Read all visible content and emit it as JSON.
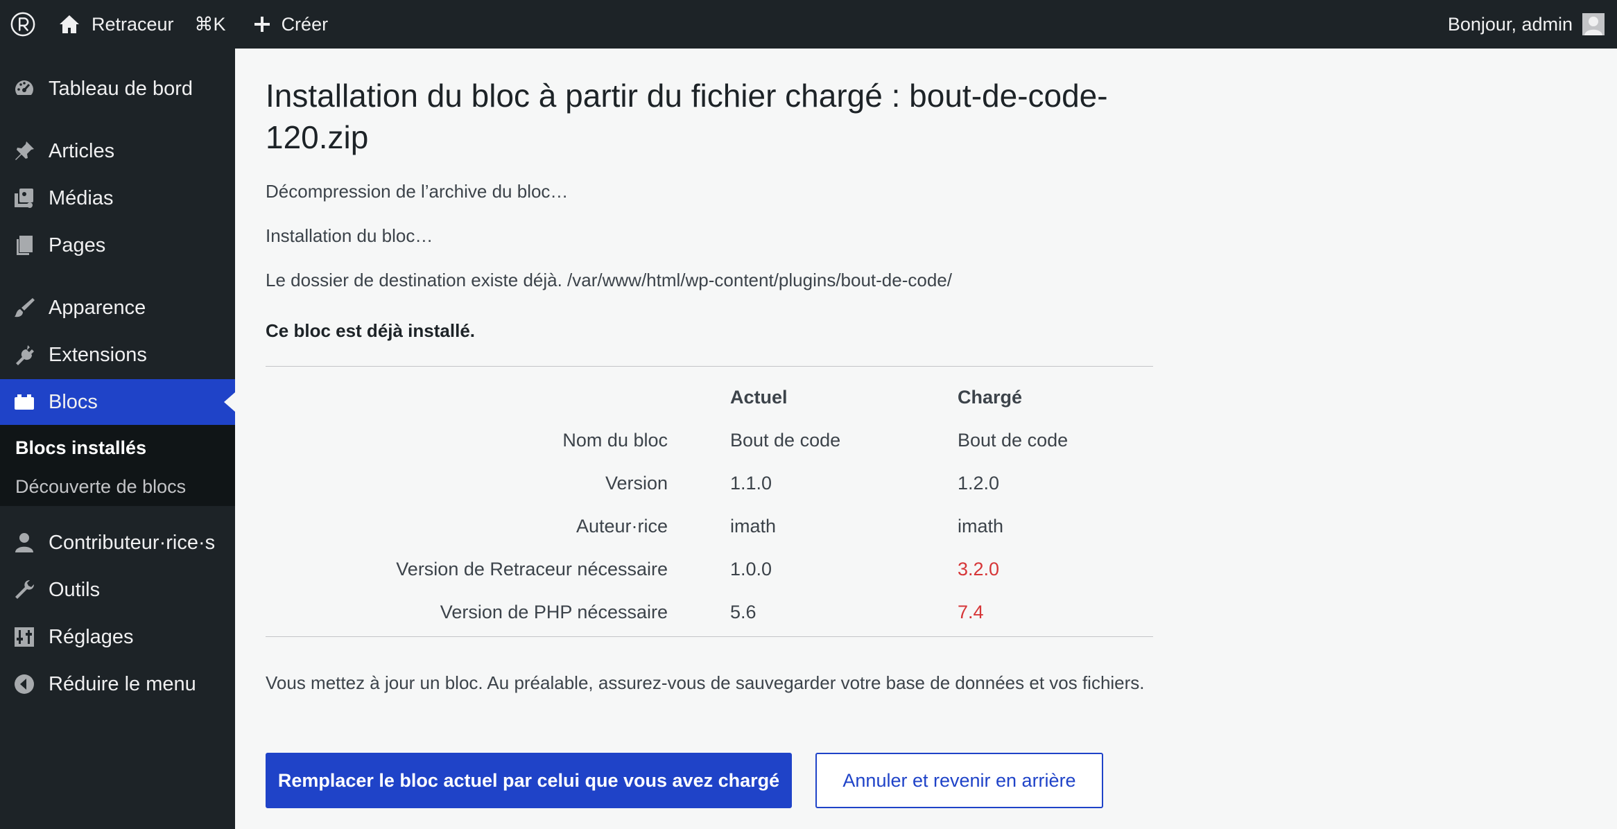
{
  "adminbar": {
    "site_name": "Retraceur",
    "shortcut": "⌘K",
    "new_label": "Créer",
    "greeting": "Bonjour, admin"
  },
  "sidebar": {
    "items": [
      {
        "label": "Tableau de bord",
        "icon": "dashboard-icon"
      },
      {
        "label": "Articles",
        "icon": "pin-icon"
      },
      {
        "label": "Médias",
        "icon": "media-icon"
      },
      {
        "label": "Pages",
        "icon": "pages-icon"
      },
      {
        "label": "Apparence",
        "icon": "brush-icon"
      },
      {
        "label": "Extensions",
        "icon": "plugin-icon"
      },
      {
        "label": "Blocs",
        "icon": "blocks-icon",
        "current": true
      },
      {
        "label": "Contributeur·rice·s",
        "icon": "user-icon"
      },
      {
        "label": "Outils",
        "icon": "wrench-icon"
      },
      {
        "label": "Réglages",
        "icon": "settings-icon"
      },
      {
        "label": "Réduire le menu",
        "icon": "collapse-icon"
      }
    ],
    "submenu": [
      {
        "label": "Blocs installés",
        "active": true
      },
      {
        "label": "Découverte de blocs"
      }
    ]
  },
  "main": {
    "title": "Installation du bloc à partir du fichier chargé : bout-de-code-120.zip",
    "messages": [
      "Décompression de l’archive du bloc…",
      "Installation du bloc…",
      "Le dossier de destination existe déjà. /var/www/html/wp-content/plugins/bout-de-code/"
    ],
    "already_installed": "Ce bloc est déjà installé.",
    "table": {
      "headers": {
        "current": "Actuel",
        "uploaded": "Chargé"
      },
      "rows": [
        {
          "label": "Nom du bloc",
          "current": "Bout de code",
          "uploaded": "Bout de code"
        },
        {
          "label": "Version",
          "current": "1.1.0",
          "uploaded": "1.2.0"
        },
        {
          "label": "Auteur·rice",
          "current": "imath",
          "uploaded": "imath"
        },
        {
          "label": "Version de Retraceur nécessaire",
          "current": "1.0.0",
          "uploaded": "3.2.0"
        },
        {
          "label": "Version de PHP nécessaire",
          "current": "5.6",
          "uploaded": "7.4"
        }
      ]
    },
    "notice": "Vous mettez à jour un bloc. Au préalable, assurez-vous de sauvegarder votre base de données et vos fichiers.",
    "replace_button": "Remplacer le bloc actuel par celui que vous avez chargé",
    "cancel_button": "Annuler et revenir en arrière"
  },
  "colors": {
    "accent": "#1f43c8",
    "warning": "#d63638",
    "sidebar_bg": "#1d2327"
  }
}
